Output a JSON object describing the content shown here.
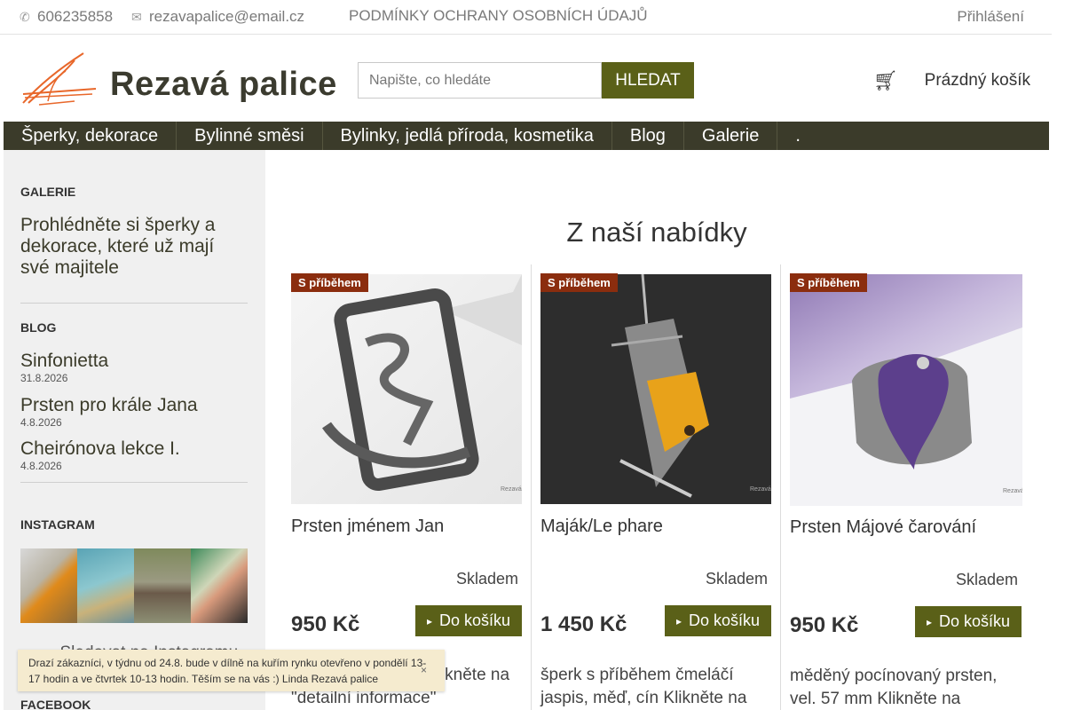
{
  "topbar": {
    "phone": "606235858",
    "email": "rezavapalice@email.cz",
    "privacy": "PODMÍNKY OCHRANY OSOBNÍCH ÚDAJŮ",
    "login": "Přihlášení"
  },
  "header": {
    "logo_text": "Rezavá palice",
    "search_placeholder": "Napište, co hledáte",
    "search_button": "HLEDAT",
    "cart_label": "Prázdný košík"
  },
  "nav": {
    "items": [
      "Šperky, dekorace",
      "Bylinné směsi",
      "Bylinky, jedlá příroda, kosmetika",
      "Blog",
      "Galerie",
      "."
    ]
  },
  "sidebar": {
    "gallery_head": "GALERIE",
    "gallery_link": "Prohlédněte si šperky a dekorace, které už mají své majitele",
    "blog_head": "BLOG",
    "blog_posts": [
      {
        "title": "Sinfonietta",
        "date": "31.8.2026"
      },
      {
        "title": "Prsten pro krále Jana",
        "date": "4.8.2026"
      },
      {
        "title": "Cheirónova lekce I.",
        "date": "4.8.2026"
      }
    ],
    "instagram_head": "INSTAGRAM",
    "instagram_follow": "Sledovat na Instagramu",
    "facebook_head": "FACEBOOK"
  },
  "main": {
    "title": "Z naší nabídky",
    "products": [
      {
        "badge": "S příběhem",
        "name": "Prsten jménem Jan",
        "stock": "Skladem",
        "price": "950 Kč",
        "buy": "Do košíku",
        "desc": "šperk, vel. 61 mm klikněte na \"detailní informace\""
      },
      {
        "badge": "S příběhem",
        "name": "Maják/Le phare",
        "stock": "Skladem",
        "price": "1 450 Kč",
        "buy": "Do košíku",
        "desc": "šperk s příběhem čmeláčí jaspis, měď, cín Klikněte na"
      },
      {
        "badge": "S příběhem",
        "name": "Prsten Májové čarování",
        "stock": "Skladem",
        "price": "950 Kč",
        "buy": "Do košíku",
        "desc": "měděný pocínovaný prsten, vel. 57 mm Klikněte na"
      }
    ]
  },
  "notice": {
    "text": "Drazí zákazníci, v týdnu od 24.8. bude v dílně na kuřím rynku otevřeno v pondělí 13-17 hodin a ve čtvrtek 10-13 hodin. Těším se na vás :) Linda Rezavá palice",
    "close": "×"
  },
  "colors": {
    "accent": "#5a6018",
    "nav_bg": "#3b3b2a",
    "badge": "#8b2d0e",
    "logo_orange": "#e8672a"
  }
}
